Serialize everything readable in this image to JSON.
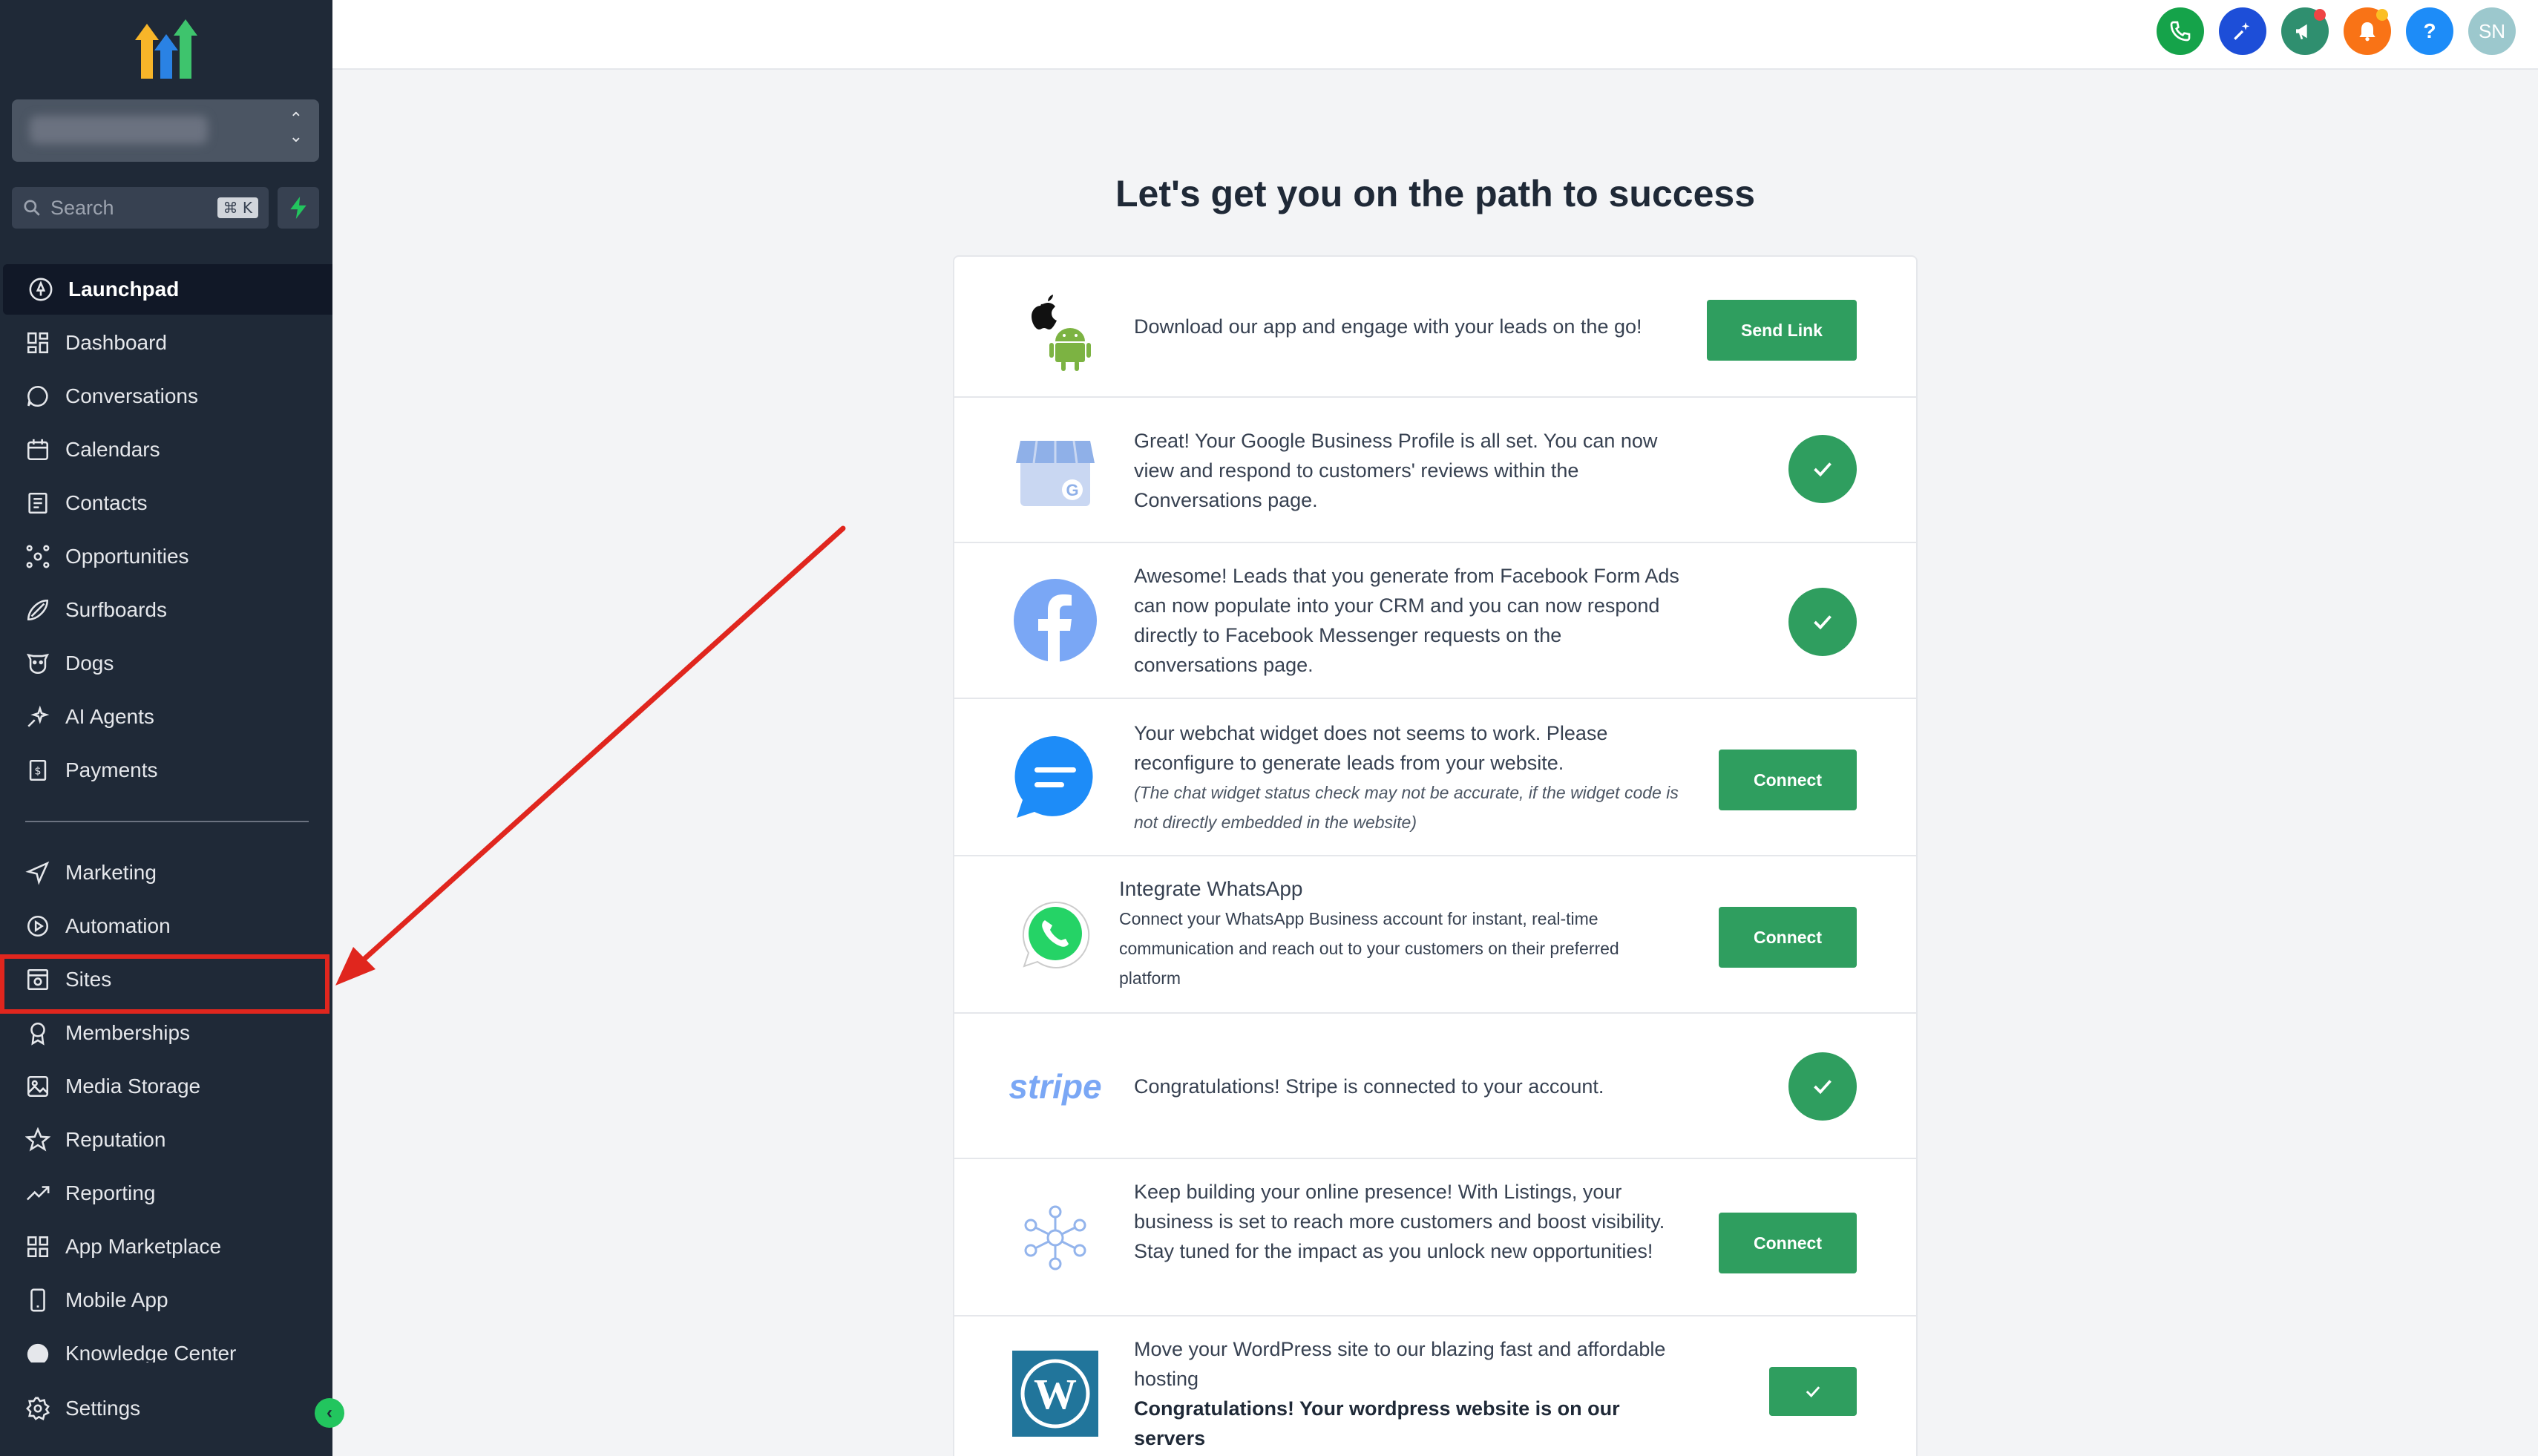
{
  "sidebar": {
    "search_placeholder": "Search",
    "search_shortcut": "⌘ K",
    "items_top": [
      {
        "label": "Launchpad",
        "icon": "rocket-icon"
      },
      {
        "label": "Dashboard",
        "icon": "grid-icon"
      },
      {
        "label": "Conversations",
        "icon": "chat-icon"
      },
      {
        "label": "Calendars",
        "icon": "calendar-icon"
      },
      {
        "label": "Contacts",
        "icon": "contacts-icon"
      },
      {
        "label": "Opportunities",
        "icon": "opportunities-icon"
      },
      {
        "label": "Surfboards",
        "icon": "surfboard-icon"
      },
      {
        "label": "Dogs",
        "icon": "dog-icon"
      },
      {
        "label": "AI Agents",
        "icon": "sparkle-icon"
      },
      {
        "label": "Payments",
        "icon": "payments-icon"
      }
    ],
    "items_bottom": [
      {
        "label": "Marketing",
        "icon": "send-icon"
      },
      {
        "label": "Automation",
        "icon": "automation-icon"
      },
      {
        "label": "Sites",
        "icon": "sites-icon"
      },
      {
        "label": "Memberships",
        "icon": "award-icon"
      },
      {
        "label": "Media Storage",
        "icon": "image-icon"
      },
      {
        "label": "Reputation",
        "icon": "star-icon"
      },
      {
        "label": "Reporting",
        "icon": "trend-icon"
      },
      {
        "label": "App Marketplace",
        "icon": "apps-icon"
      },
      {
        "label": "Mobile App",
        "icon": "phone-icon"
      }
    ],
    "knowledge_label": "Knowledge Center",
    "settings_label": "Settings",
    "collapse_icon": "chevron-left-icon"
  },
  "header": {
    "buttons": [
      {
        "name": "phone-button",
        "icon": "phone-icon",
        "color": "#15a34a"
      },
      {
        "name": "ai-button",
        "icon": "magic-wand-icon",
        "color": "#1d4ed8"
      },
      {
        "name": "announcements-button",
        "icon": "megaphone-icon",
        "color": "#2f8f6f"
      },
      {
        "name": "notifications-button",
        "icon": "bell-icon",
        "color": "#f97316"
      },
      {
        "name": "help-button",
        "icon": "question-icon",
        "color": "#1d8cf8",
        "label": "?"
      },
      {
        "name": "avatar",
        "icon": "avatar-icon",
        "color": "#9cc8cd",
        "label": "SN"
      }
    ]
  },
  "main": {
    "title": "Let's get you on the path to success",
    "tasks": [
      {
        "id": "app",
        "icon": "apple-android-icon",
        "text": "Download our app and engage with your leads on the go!",
        "action": "button",
        "button_label": "Send Link"
      },
      {
        "id": "google",
        "icon": "google-business-icon",
        "text": "Great! Your Google Business Profile is all set. You can now view and respond to customers' reviews within the Conversations page.",
        "action": "check"
      },
      {
        "id": "facebook",
        "icon": "facebook-icon",
        "text": "Awesome! Leads that you generate from Facebook Form Ads can now populate into your CRM and you can now respond directly to Facebook Messenger requests on the conversations page.",
        "action": "check"
      },
      {
        "id": "webchat",
        "icon": "webchat-icon",
        "text": "Your webchat widget does not seems to work. Please reconfigure to generate leads from your website.",
        "note": "(The chat widget status check may not be accurate, if the widget code is not directly embedded in the website)",
        "action": "button",
        "button_label": "Connect"
      },
      {
        "id": "whatsapp",
        "icon": "whatsapp-icon",
        "title": "Integrate WhatsApp",
        "text": "Connect your WhatsApp Business account for instant, real-time communication and reach out to your customers on their preferred platform",
        "action": "button",
        "button_label": "Connect"
      },
      {
        "id": "stripe",
        "icon": "stripe-icon",
        "icon_text": "stripe",
        "text": "Congratulations! Stripe is connected to your account.",
        "action": "check"
      },
      {
        "id": "listings",
        "icon": "listings-network-icon",
        "text": "Keep building your online presence! With Listings, your business is set to reach more customers and boost visibility. Stay tuned for the impact as you unlock new opportunities!",
        "action": "button",
        "button_label": "Connect"
      },
      {
        "id": "wordpress",
        "icon": "wordpress-icon",
        "text": "Move your WordPress site to our blazing fast and affordable hosting",
        "bold_text": "Congratulations! Your wordpress website is on our servers",
        "action": "small-check"
      }
    ]
  },
  "colors": {
    "sidebar_bg": "#1f2937",
    "accent_green": "#2f9e5f",
    "highlight_red": "#e0261e"
  }
}
